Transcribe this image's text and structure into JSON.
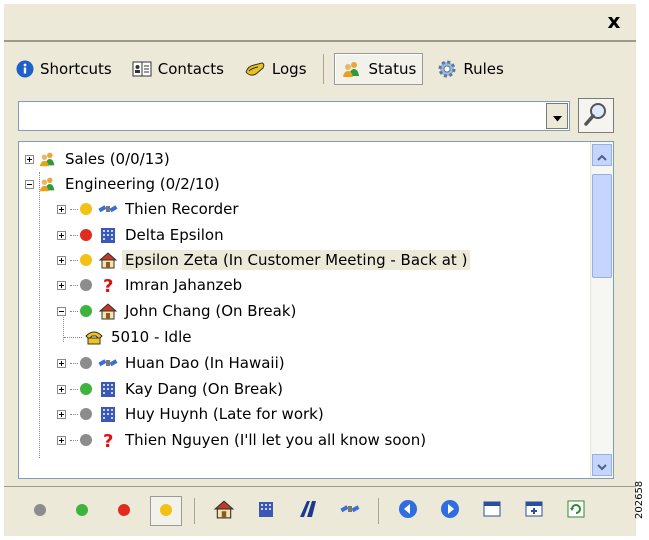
{
  "window": {
    "close_label": "x"
  },
  "toolbar": {
    "tabs": [
      {
        "label": "Shortcuts",
        "icon": "info-icon"
      },
      {
        "label": "Contacts",
        "icon": "contacts-icon"
      },
      {
        "label": "Logs",
        "icon": "logs-icon"
      },
      {
        "label": "Status",
        "icon": "status-people-icon",
        "active": true
      },
      {
        "label": "Rules",
        "icon": "gear-icon"
      }
    ]
  },
  "search": {
    "value": "",
    "placeholder": ""
  },
  "tree": {
    "groups": [
      {
        "label": "Sales  (0/0/13)",
        "expanded": false
      },
      {
        "label": "Engineering  (0/2/10)",
        "expanded": true
      }
    ],
    "contacts": [
      {
        "label": "Thien Recorder",
        "status_color": "#f3c013",
        "icon": "satellite-icon",
        "expanded": false
      },
      {
        "label": "Delta Epsilon",
        "status_color": "#e22b1f",
        "icon": "office-building-icon",
        "expanded": false
      },
      {
        "label": "Epsilon Zeta (In Customer Meeting - Back at )",
        "status_color": "#f3c013",
        "icon": "home-icon",
        "expanded": false,
        "selected": true
      },
      {
        "label": "Imran Jahanzeb",
        "status_color": "#8c8c8c",
        "icon": "question-mark-icon",
        "expanded": false
      },
      {
        "label": "John Chang (On Break)",
        "status_color": "#3eb33e",
        "icon": "home-icon",
        "expanded": true
      },
      {
        "label": "5010 - Idle",
        "icon": "phone-icon",
        "child": true
      },
      {
        "label": "Huan Dao (In Hawaii)",
        "status_color": "#8c8c8c",
        "icon": "satellite-icon",
        "expanded": false
      },
      {
        "label": "Kay Dang (On Break)",
        "status_color": "#3eb33e",
        "icon": "office-building-icon",
        "expanded": false
      },
      {
        "label": "Huy Huynh (Late for work)",
        "status_color": "#8c8c8c",
        "icon": "office-building-icon",
        "expanded": false
      },
      {
        "label": "Thien Nguyen (I'll let you all know soon)",
        "status_color": "#8c8c8c",
        "icon": "question-mark-icon",
        "expanded": false
      }
    ]
  },
  "bottom_toolbar": {
    "status_buttons": [
      {
        "icon": "status-gray-dot-icon",
        "color": "#8c8c8c"
      },
      {
        "icon": "status-green-dot-icon",
        "color": "#3eb33e"
      },
      {
        "icon": "status-red-dot-icon",
        "color": "#e22b1f"
      },
      {
        "icon": "status-yellow-dot-icon",
        "color": "#f3c013",
        "active": true
      }
    ],
    "location_buttons": [
      "home-icon",
      "office-building-icon",
      "road-icon",
      "satellite-icon"
    ],
    "nav_buttons": [
      "back-arrow-icon",
      "forward-arrow-icon",
      "window-icon",
      "window-expand-icon",
      "refresh-icon"
    ]
  },
  "figure_number": "202658"
}
